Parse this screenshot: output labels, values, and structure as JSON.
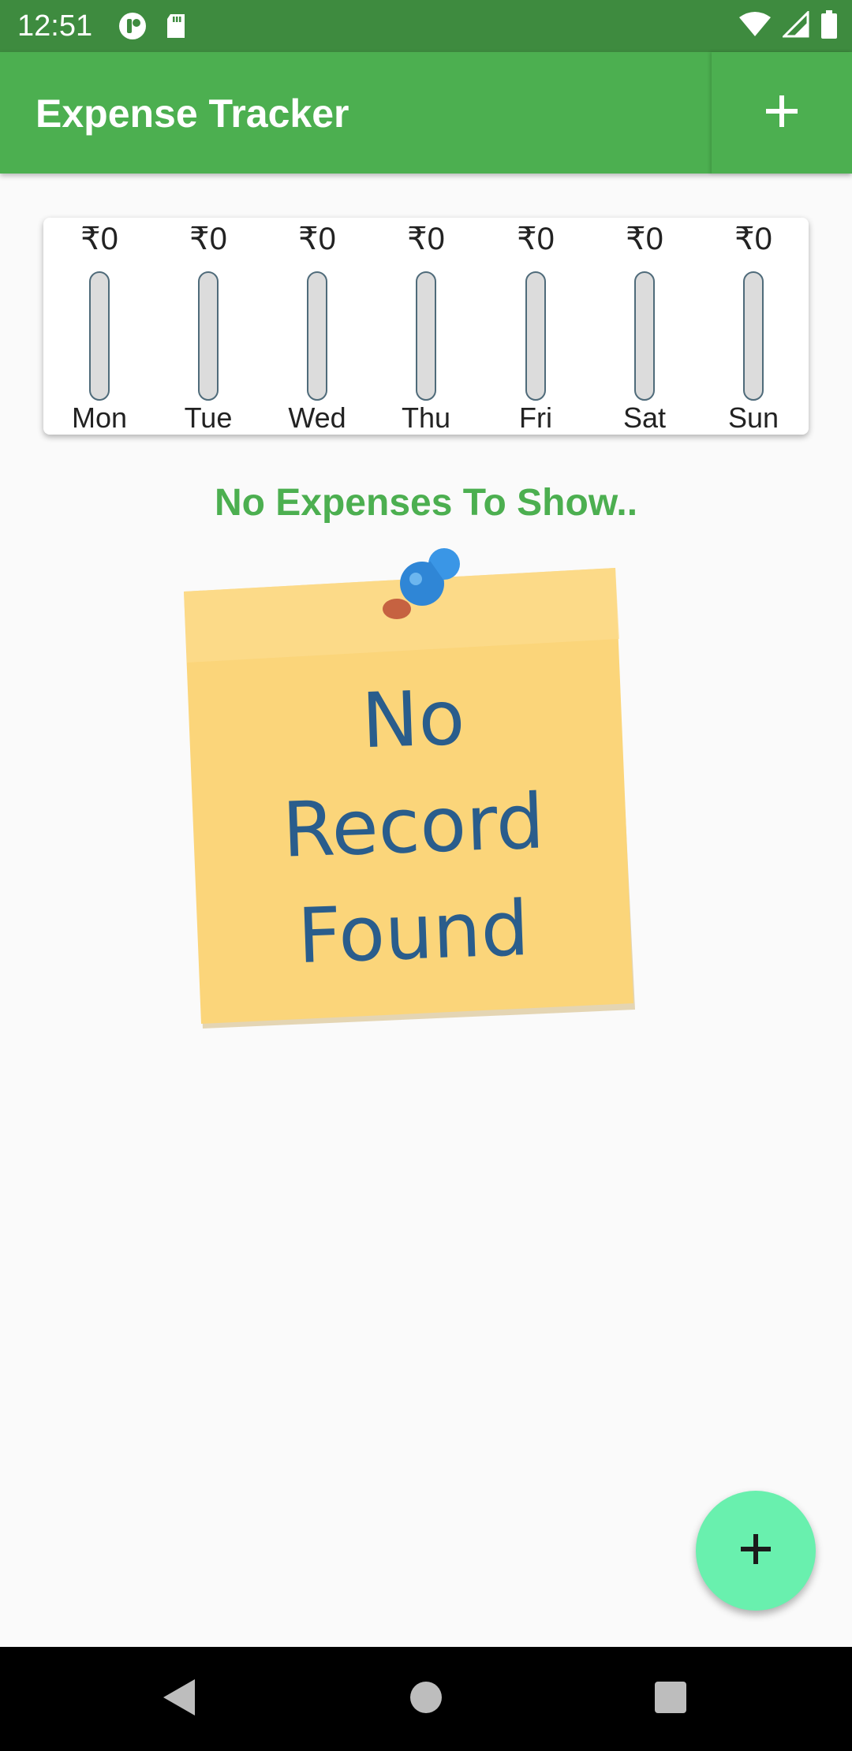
{
  "status_bar": {
    "time": "12:51"
  },
  "app_bar": {
    "title": "Expense Tracker"
  },
  "chart": {
    "days": [
      {
        "amount": "₹0",
        "label": "Mon",
        "fraction": 0
      },
      {
        "amount": "₹0",
        "label": "Tue",
        "fraction": 0
      },
      {
        "amount": "₹0",
        "label": "Wed",
        "fraction": 0
      },
      {
        "amount": "₹0",
        "label": "Thu",
        "fraction": 0
      },
      {
        "amount": "₹0",
        "label": "Fri",
        "fraction": 0
      },
      {
        "amount": "₹0",
        "label": "Sat",
        "fraction": 0
      },
      {
        "amount": "₹0",
        "label": "Sun",
        "fraction": 0
      }
    ]
  },
  "empty_state": {
    "message": "No Expenses To Show..",
    "image_text": [
      "No",
      "Record",
      "Found"
    ]
  },
  "colors": {
    "primary": "#4caf50",
    "status_bar": "#3e8b3f",
    "fab": "#69f0ae",
    "note": "#fbd57a"
  },
  "icons": {
    "appbar_add": "plus-icon",
    "fab": "plus-icon"
  }
}
